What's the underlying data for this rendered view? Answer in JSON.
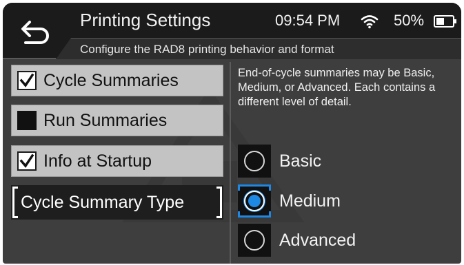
{
  "header": {
    "title": "Printing Settings",
    "subtitle": "Configure the RAD8 printing behavior and format",
    "time": "09:54 PM",
    "battery_percent": "50%",
    "back_icon": "back-arrow-icon",
    "wifi_icon": "wifi-icon",
    "battery_icon": "battery-half-icon"
  },
  "options": [
    {
      "label": "Cycle Summaries",
      "checked": true
    },
    {
      "label": "Run Summaries",
      "checked": false
    },
    {
      "label": "Info at Startup",
      "checked": true
    }
  ],
  "summary_type_button": {
    "label": "Cycle Summary Type"
  },
  "panel": {
    "description": "End-of-cycle summaries may be Basic, Medium, or Advanced. Each contains a different level of detail.",
    "radios": [
      {
        "label": "Basic",
        "selected": false
      },
      {
        "label": "Medium",
        "selected": true
      },
      {
        "label": "Advanced",
        "selected": false
      }
    ]
  },
  "colors": {
    "background": "#3e3e3e",
    "header": "#1b1b1b",
    "option_bg": "#c3c3c3",
    "accent": "#1e88e5"
  }
}
